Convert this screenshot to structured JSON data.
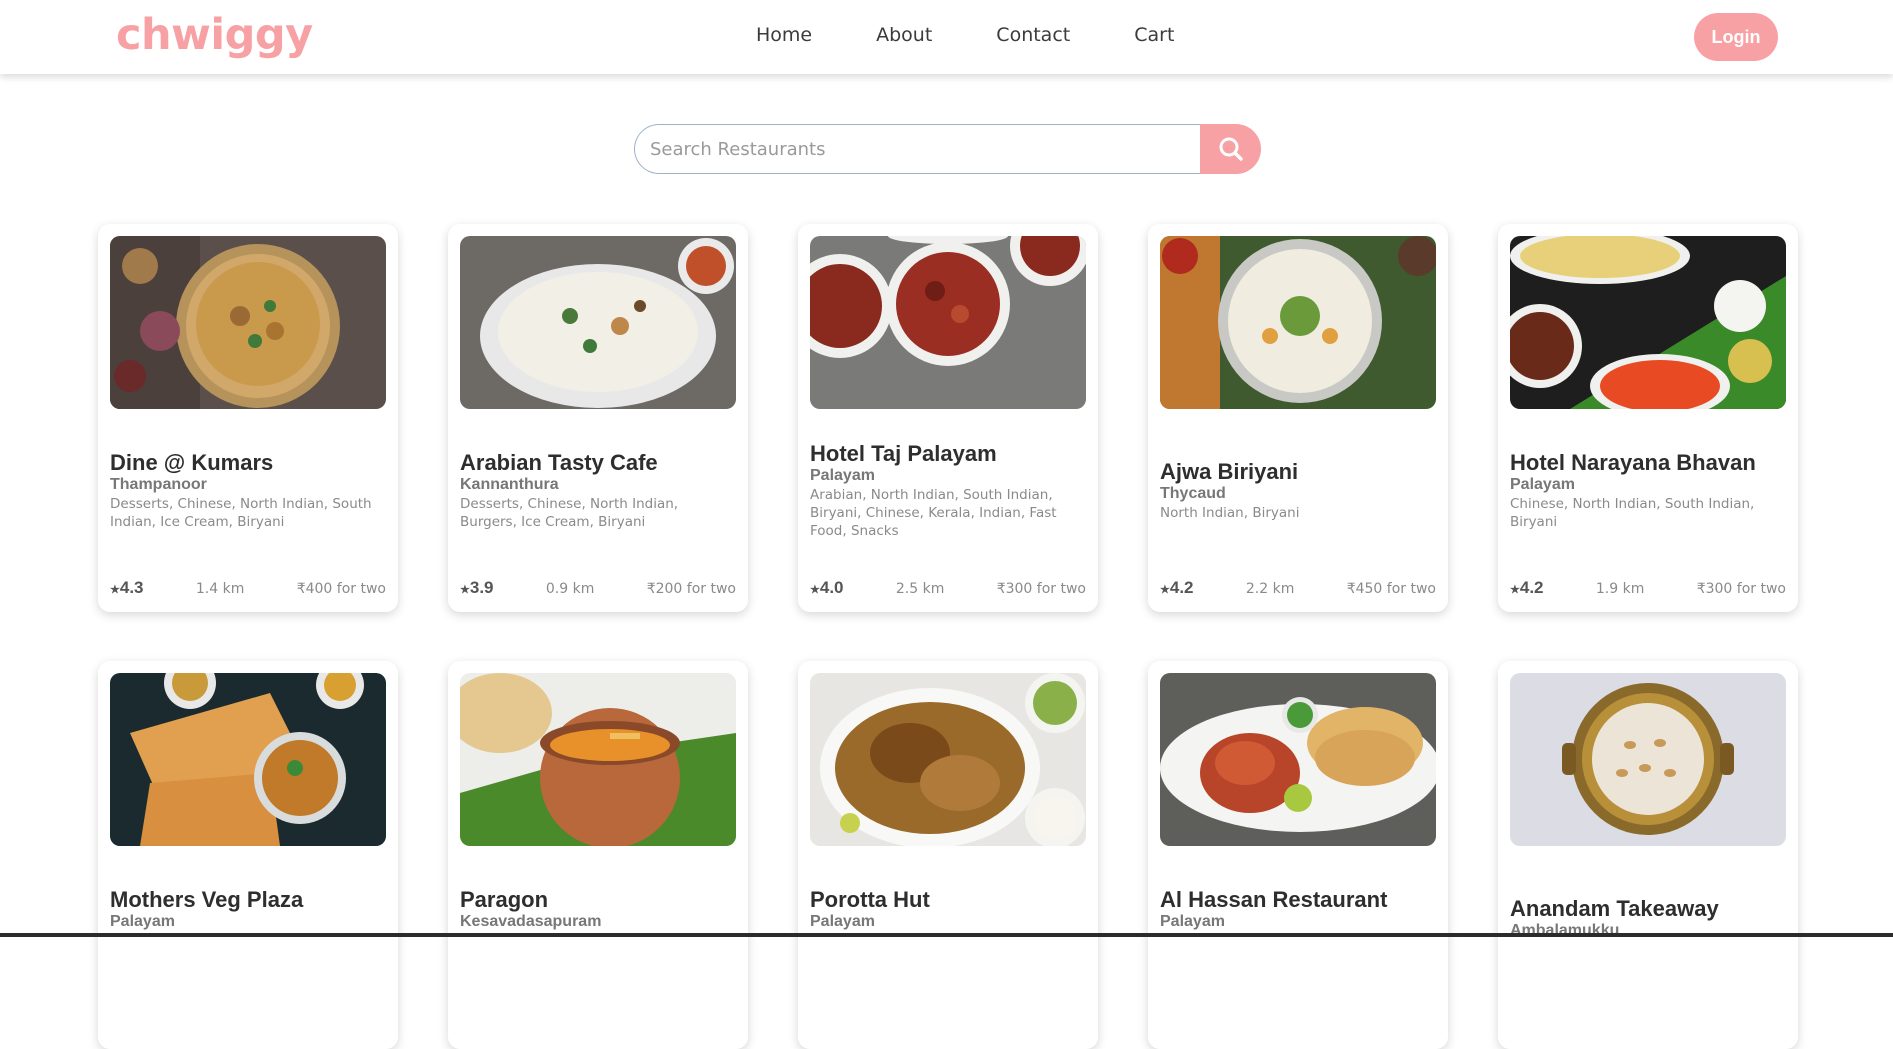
{
  "brand": {
    "logo": "chwiggy",
    "accent": "#f8a1a4"
  },
  "nav": {
    "links": [
      "Home",
      "About",
      "Contact",
      "Cart"
    ],
    "login_label": "Login"
  },
  "search": {
    "placeholder": "Search Restaurants",
    "icon": "search-icon"
  },
  "restaurants": [
    {
      "name": "Dine @ Kumars",
      "area": "Thampanoor",
      "cuisines": "Desserts, Chinese, North Indian, South Indian, Ice Cream, Biryani",
      "rating": "4.3",
      "distance": "1.4 km",
      "cost": "₹400 for two"
    },
    {
      "name": "Arabian Tasty Cafe",
      "area": "Kannanthura",
      "cuisines": "Desserts, Chinese, North Indian, Burgers, Ice Cream, Biryani",
      "rating": "3.9",
      "distance": "0.9 km",
      "cost": "₹200 for two"
    },
    {
      "name": "Hotel Taj Palayam",
      "area": "Palayam",
      "cuisines": "Arabian, North Indian, South Indian, Biryani, Chinese, Kerala, Indian, Fast Food, Snacks",
      "rating": "4.0",
      "distance": "2.5 km",
      "cost": "₹300 for two"
    },
    {
      "name": "Ajwa Biriyani",
      "area": "Thycaud",
      "cuisines": "North Indian, Biryani",
      "rating": "4.2",
      "distance": "2.2 km",
      "cost": "₹450 for two"
    },
    {
      "name": "Hotel Narayana Bhavan",
      "area": "Palayam",
      "cuisines": "Chinese, North Indian, South Indian, Biryani",
      "rating": "4.2",
      "distance": "1.9 km",
      "cost": "₹300 for two"
    },
    {
      "name": "Mothers Veg Plaza",
      "area": "Palayam"
    },
    {
      "name": "Paragon",
      "area": "Kesavadasapuram"
    },
    {
      "name": "Porotta Hut",
      "area": "Palayam"
    },
    {
      "name": "Al Hassan Restaurant",
      "area": "Palayam"
    },
    {
      "name": "Anandam Takeaway",
      "area": "Ambalamukku"
    }
  ]
}
